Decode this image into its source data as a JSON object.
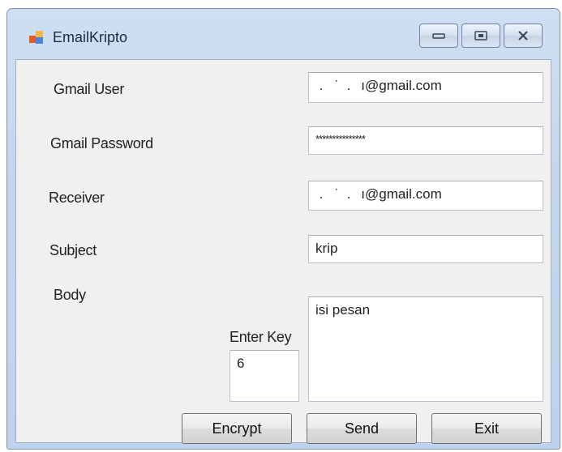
{
  "window": {
    "title": "EmailKripto"
  },
  "labels": {
    "gmail_user": "Gmail User",
    "gmail_password": "Gmail Password",
    "receiver": "Receiver",
    "subject": "Subject",
    "body": "Body",
    "enter_key": "Enter Key"
  },
  "fields": {
    "gmail_user": " .   ˙  .   ı@gmail.com",
    "gmail_password": "***************",
    "receiver": " .   ˙  .   ı@gmail.com",
    "subject": "krip",
    "body": "isi pesan",
    "key": "6"
  },
  "buttons": {
    "encrypt": "Encrypt",
    "send": "Send",
    "exit": "Exit"
  },
  "icons": {
    "app": "app-icon",
    "minimize": "minimize-icon",
    "maximize": "maximize-icon",
    "close": "close-icon"
  }
}
